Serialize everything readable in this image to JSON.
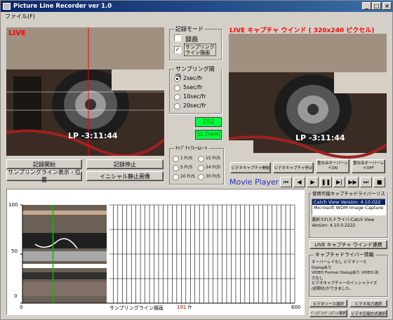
{
  "window": {
    "title": "Picture Line Recorder ver 1.0"
  },
  "menu": {
    "file": "ファイル(F)"
  },
  "left_preview": {
    "live_tag": "LIVE",
    "timecode": "LP   -3:11:44"
  },
  "recording_mode": {
    "title": "記録モード",
    "record_label": "録画",
    "record_checked": false,
    "sampling_line_label": "サンプリング\nライン描画",
    "sampling_line_checked": true
  },
  "sampling_interval": {
    "title": "サンプリング間隔",
    "options": [
      "2sec/fr",
      "5sec/fr",
      "10sec/fr",
      "20sec/fr"
    ],
    "selected": 0
  },
  "counters": {
    "frame_count": "282",
    "st_frame": "St.frem"
  },
  "capture_rate": {
    "title": "ｷｬﾌﾟﾁｬﾌﾚｰﾑﾚｰﾄ",
    "options": [
      "1 Fr/S",
      "15 Fr/S",
      "5 Fr/S",
      "24 Fr/S",
      "10 Fr/S",
      "30 Fr/S"
    ]
  },
  "buttons": {
    "record_start": "記録開始",
    "record_stop": "記録停止",
    "sampling_line_position": "サンプリングライン表示・位置",
    "initial_still": "イニシャル静止画像",
    "video_capture_start": "ビデオキャプチャ開始",
    "video_capture_stop": "ビデオキャプチャ停止",
    "overlay_on": "重ね合オーバーレイON",
    "overlay_off": "重ね合オーバーレイOFF",
    "live_window_link": "LIVE キャプチャ ウインド連携",
    "video_source": "ビデオソース選択",
    "video_output": "ビデオ出力選択",
    "display_select": "ﾃﾞｨｽﾌﾟﾚｲﾃﾞｨｽﾌﾟﾚｲ選択",
    "compression_select": "ビデオ圧縮方式選択"
  },
  "right_preview": {
    "title": "LIVE キャプチャ ウインド ( 320x240 ピクセル)",
    "timecode": "LP   -3:11:44"
  },
  "movie_player": {
    "label": "Movie Player"
  },
  "driver_list": {
    "title": "使用可能キャプチャドライバーリスト",
    "items": [
      "Catch View Version: 4.10.022",
      "Microsoft WDM Image Capture"
    ],
    "selected": 0,
    "selected_info": "選択されたドライバ:Catch View\nVersion: 4.10.0.2222"
  },
  "driver_info": {
    "title": "キャプチャドライバー情報",
    "text": "オーバーレイなし ビデオソース\nDialogあり\nVIDEO Format Dialogあり VIDEO 出\n力なし\nビデオキャプチャーのインシャライズ\n(初期化)ができました。"
  },
  "chart": {
    "y_ticks": [
      "100",
      "50",
      "0"
    ],
    "x_ticks": [
      "0",
      "600"
    ],
    "sampling_line_label": "サンプリングライン描画",
    "sampling_position": "191",
    "sampling_unit": "fr"
  },
  "chart_data": {
    "type": "line",
    "xlim": [
      0,
      600
    ],
    "ylim": [
      0,
      100
    ],
    "sampling_line_x": 191,
    "grid": true
  }
}
